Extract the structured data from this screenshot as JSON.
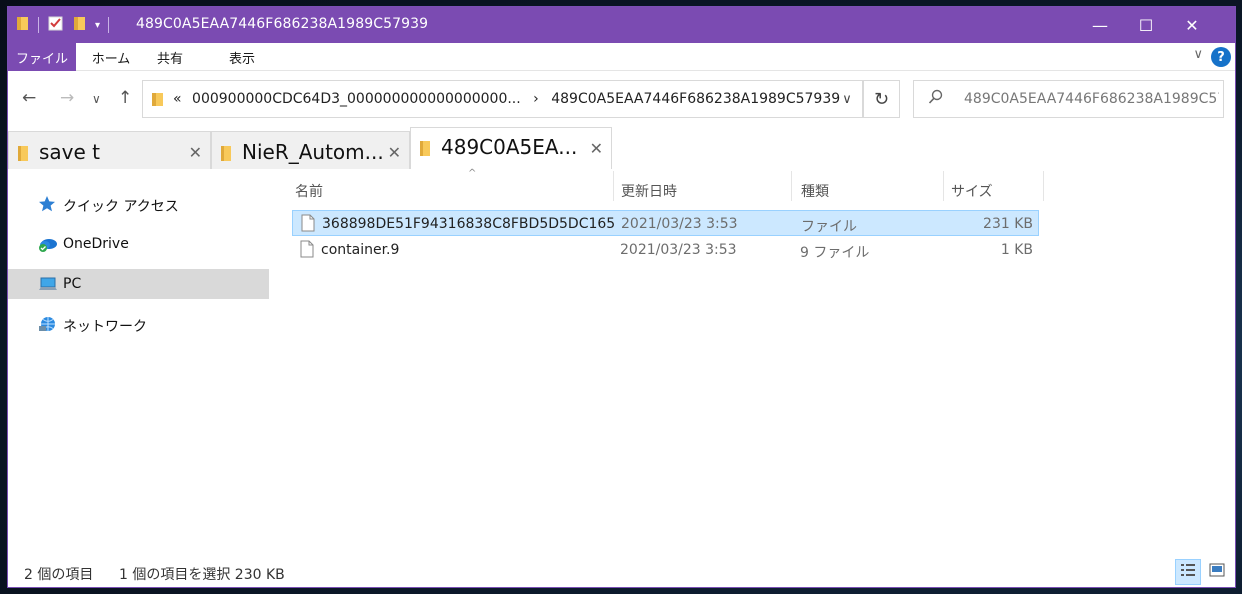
{
  "window": {
    "title": "489C0A5EAA7446F686238A1989C57939",
    "minimize": "—",
    "maximize": "☐",
    "close": "✕"
  },
  "ribbon": {
    "tabs": [
      "ファイル",
      "ホーム",
      "共有",
      "表示"
    ],
    "collapse_glyph": "∨",
    "help_glyph": "?"
  },
  "nav": {
    "back": "←",
    "forward": "→",
    "recent": "∨",
    "up": "↑",
    "address_overflow": "«",
    "address_segments": [
      "000900000CDC64D3_000000000000000000...",
      "489C0A5EAA7446F686238A1989C57939"
    ],
    "address_sep": "›",
    "address_dropdown": "∨",
    "refresh": "↻",
    "search_placeholder": "489C0A5EAA7446F686238A1989C579..."
  },
  "folder_tabs": [
    {
      "label": "save t",
      "active": false
    },
    {
      "label": "NieR_Autom...",
      "active": false
    },
    {
      "label": "489C0A5EA...",
      "active": true
    }
  ],
  "tab_close": "✕",
  "sidebar": {
    "items": [
      {
        "label": "クイック アクセス",
        "icon": "star-icon"
      },
      {
        "label": "OneDrive",
        "icon": "onedrive-icon"
      },
      {
        "label": "PC",
        "icon": "pc-icon",
        "selected": true
      },
      {
        "label": "ネットワーク",
        "icon": "network-icon"
      }
    ]
  },
  "columns": {
    "name": "名前",
    "date": "更新日時",
    "type": "種類",
    "size": "サイズ",
    "sort_caret": "^"
  },
  "files": [
    {
      "name": "368898DE51F94316838C8FBD5D5DC165",
      "date": "2021/03/23 3:53",
      "type": "ファイル",
      "size": "231 KB",
      "selected": true
    },
    {
      "name": "container.9",
      "date": "2021/03/23 3:53",
      "type": "9 ファイル",
      "size": "1 KB",
      "selected": false
    }
  ],
  "status": {
    "item_count": "2 個の項目",
    "selection": "1 個の項目を選択  230 KB"
  },
  "colors": {
    "accent": "#7b4bb2",
    "selection": "#cce8ff",
    "folder": "#f8c95a"
  }
}
